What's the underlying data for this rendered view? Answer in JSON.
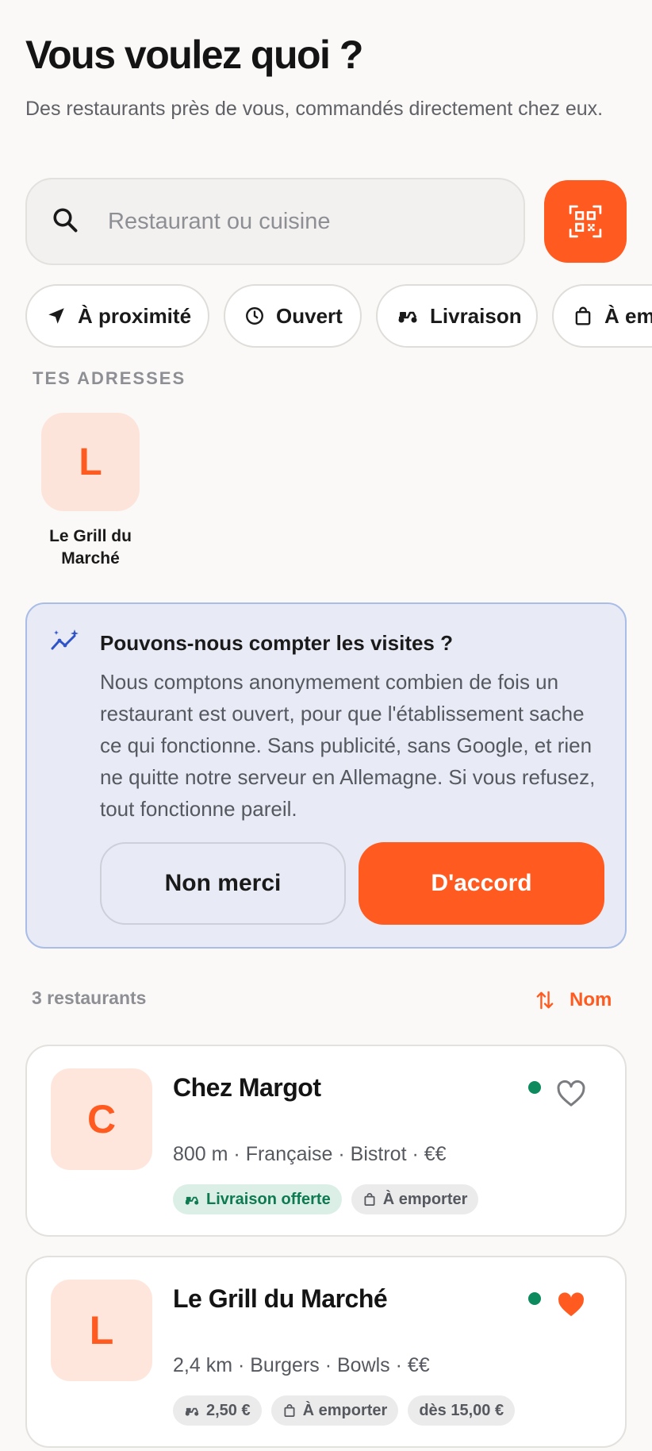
{
  "header": {
    "title": "Vous voulez quoi ?",
    "subtitle": "Des restaurants près de vous, commandés directement chez eux."
  },
  "search": {
    "placeholder": "Restaurant ou cuisine",
    "value": "",
    "icon": "search-icon",
    "qr_icon": "qr-code-icon"
  },
  "filters": [
    {
      "label": "À proximité",
      "icon": "navigation-arrow-icon"
    },
    {
      "label": "Ouvert",
      "icon": "clock-icon"
    },
    {
      "label": "Livraison",
      "icon": "scooter-icon"
    },
    {
      "label": "À emporter",
      "icon": "shopping-bag-icon"
    }
  ],
  "addresses": {
    "label": "TES ADRESSES",
    "items": [
      {
        "initial": "L",
        "name": "Le Grill du Marché"
      }
    ]
  },
  "consent": {
    "heading": "Pouvons-nous compter les visites ?",
    "body": "Nous comptons anonymement combien de fois un restaurant est ouvert, pour que l'établissement sache ce qui fonctionne. Sans publicité, sans Google, et rien ne quitte notre serveur en Allemagne. Si vous refusez, tout fonctionne pareil.",
    "decline_label": "Non merci",
    "accept_label": "D'accord"
  },
  "list": {
    "count_label": "3 restaurants",
    "sort_label": "Nom"
  },
  "restaurants": [
    {
      "initial": "C",
      "name": "Chez Margot",
      "meta": "800 m · Française · Bistrot · €€",
      "open": true,
      "favorite": false,
      "tags": [
        {
          "label": "Livraison offerte",
          "icon": "scooter-icon",
          "style": "green"
        },
        {
          "label": "À emporter",
          "icon": "shopping-bag-icon",
          "style": "grey"
        }
      ]
    },
    {
      "initial": "L",
      "name": "Le Grill du Marché",
      "meta": "2,4 km · Burgers · Bowls · €€",
      "open": true,
      "favorite": true,
      "tags": [
        {
          "label": "2,50 €",
          "icon": "scooter-icon",
          "style": "grey"
        },
        {
          "label": "À emporter",
          "icon": "shopping-bag-icon",
          "style": "grey"
        },
        {
          "label": "dès 15,00 €",
          "icon": "",
          "style": "grey"
        }
      ]
    }
  ],
  "colors": {
    "accent": "#ff5a1f",
    "open_status": "#0e8a5f",
    "consent_bg": "#e8ebf6",
    "consent_border": "#a9bde6"
  }
}
